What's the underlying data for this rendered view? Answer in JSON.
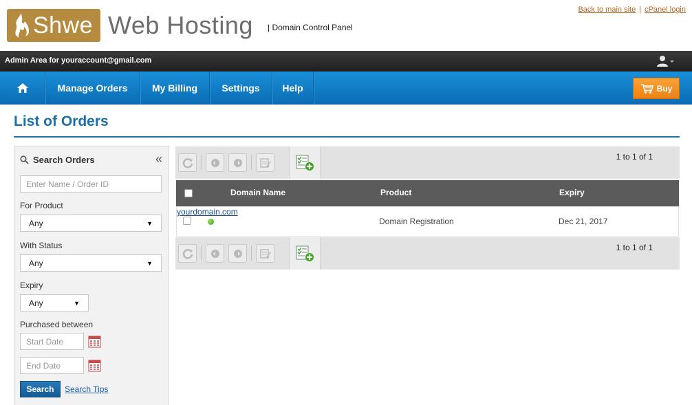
{
  "header": {
    "logo_shwe": "Shwe",
    "logo_web": "Web Hosting",
    "subtitle": "| Domain Control Panel",
    "back_link": "Back to main site",
    "cpanel_link": "cPanel login",
    "link_sep": "|"
  },
  "adminbar": {
    "text": "Admin Area for youraccount@gmail.com"
  },
  "nav": {
    "items": [
      {
        "label": "Manage Orders"
      },
      {
        "label": "My Billing"
      },
      {
        "label": "Settings"
      },
      {
        "label": "Help"
      }
    ],
    "buy_label": "Buy",
    "accent_color": "#0a6db5",
    "buy_color": "#f29220"
  },
  "page": {
    "title": "List of Orders"
  },
  "search": {
    "heading": "Search Orders",
    "collapse_icon": "«",
    "name_placeholder": "Enter Name / Order ID",
    "product_label": "For Product",
    "product_value": "Any",
    "status_label": "With Status",
    "status_value": "Any",
    "expiry_label": "Expiry",
    "expiry_value": "Any",
    "purchased_label": "Purchased between",
    "start_placeholder": "Start Date",
    "end_placeholder": "End Date",
    "search_button": "Search",
    "tips_link": "Search Tips"
  },
  "orders": {
    "pager_top": "1 to 1 of 1",
    "pager_bottom": "1 to 1 of 1",
    "columns": [
      "Domain Name",
      "Product",
      "Expiry"
    ],
    "rows": [
      {
        "domain": "yourdomain.com",
        "product": "Domain Registration",
        "expiry": "Dec 21, 2017",
        "status_color": "#3aa81a"
      }
    ]
  }
}
